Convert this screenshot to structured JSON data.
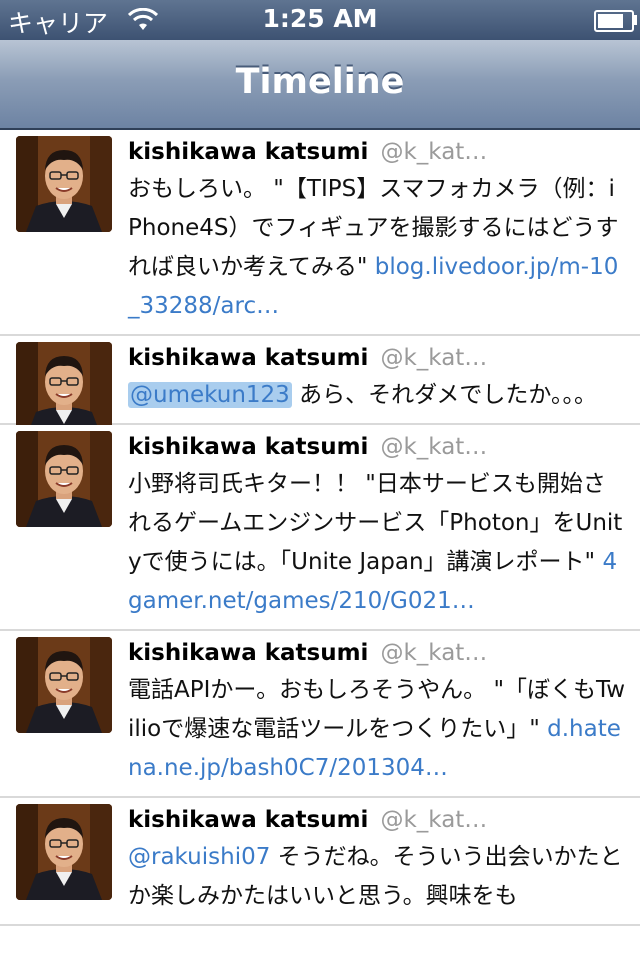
{
  "status_bar": {
    "carrier": "キャリア",
    "time": "1:25 AM",
    "battery_level": 0.9
  },
  "nav": {
    "title": "Timeline"
  },
  "tweets": [
    {
      "name": "kishikawa katsumi",
      "handle": "@k_kat…",
      "text": "おもしろい。 \"【TIPS】スマフォカメラ（例：iPhone4S）でフィギュアを撮影するにはどうすれば良いか考えてみる\" ",
      "link": "blog.livedoor.jp/m-10_33288/arc…"
    },
    {
      "name": "kishikawa katsumi",
      "handle": "@k_kat…",
      "mention": "@umekun123",
      "text": " あら、それダメでしたか。。。"
    },
    {
      "name": "kishikawa katsumi",
      "handle": "@k_kat…",
      "text": "小野将司氏キター！！ \"日本サービスも開始されるゲームエンジンサービス「Photon」をUnityで使うには。「Unite Japan」講演レポート\" ",
      "link": "4gamer.net/games/210/G021…"
    },
    {
      "name": "kishikawa katsumi",
      "handle": "@k_kat…",
      "text": "電話APIかー。おもしろそうやん。 \"「ぼくもTwilioで爆速な電話ツールをつくりたい」\" ",
      "link": "d.hatena.ne.jp/bash0C7/201304…"
    },
    {
      "name": "kishikawa katsumi",
      "handle": "@k_kat…",
      "mention": "@rakuishi07",
      "text": " そうだね。そういう出会いかたとか楽しみかたはいいと思う。興味をも"
    }
  ],
  "icons": {
    "wifi": "wifi-icon",
    "battery": "battery-icon",
    "avatar": "avatar-photo"
  },
  "colors": {
    "link": "#3b7bc8",
    "handle": "#9a9a9a",
    "selection": "#a9cdee"
  }
}
